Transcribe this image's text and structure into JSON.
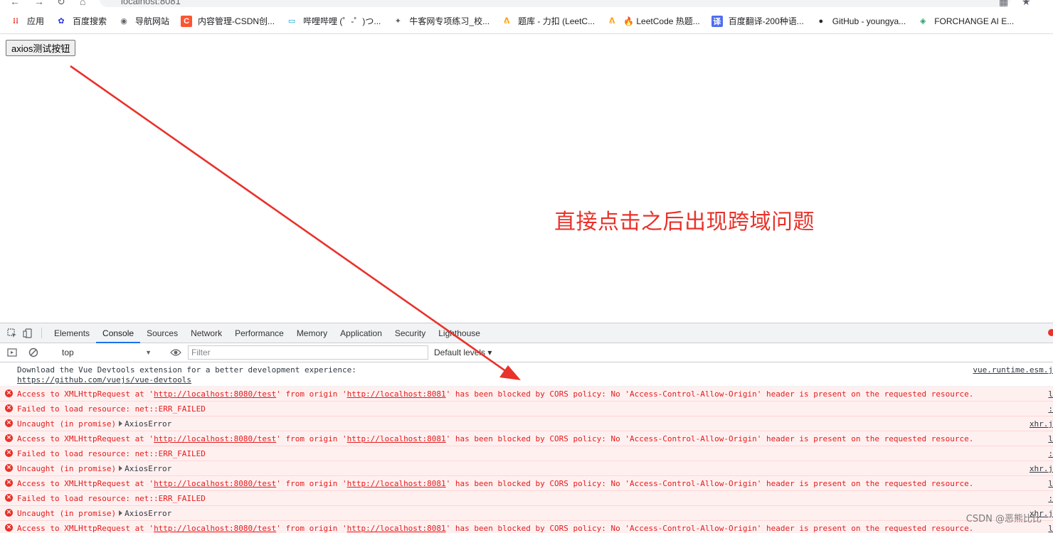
{
  "browser": {
    "address": "localhost:8081"
  },
  "bookmarks": [
    {
      "label": "应用",
      "icon": "apps-grid-icon",
      "color": "#ea4335"
    },
    {
      "label": "百度搜索",
      "icon": "baidu-paw-icon",
      "color": "#2932e1"
    },
    {
      "label": "导航网站",
      "icon": "globe-icon",
      "color": "#5f6368"
    },
    {
      "label": "内容管理-CSDN创...",
      "icon": "csdn-c-icon",
      "color": "#fc5531"
    },
    {
      "label": "哔哩哔哩 (゜-゜)つ...",
      "icon": "bilibili-tv-icon",
      "color": "#00a1d6"
    },
    {
      "label": "牛客网专项练习_校...",
      "icon": "nowcoder-icon",
      "color": "#5f6368"
    },
    {
      "label": "题库 - 力扣 (LeetC...",
      "icon": "leetcode-icon",
      "color": "#ffa116"
    },
    {
      "label": "🔥 LeetCode 热题...",
      "icon": "leetcode-icon",
      "color": "#ffa116"
    },
    {
      "label": "百度翻译-200种语...",
      "icon": "translate-icon",
      "color": "#4e6ef2"
    },
    {
      "label": "GitHub - youngya...",
      "icon": "github-icon",
      "color": "#24292e"
    },
    {
      "label": "FORCHANGE AI E...",
      "icon": "forchange-icon",
      "color": "#21a366"
    }
  ],
  "page": {
    "button_label": "axios测试按钮",
    "annotation": "直接点击之后出现跨域问题",
    "annotation_color": "#e8322a"
  },
  "devtools": {
    "tabs": [
      "Elements",
      "Console",
      "Sources",
      "Network",
      "Performance",
      "Memory",
      "Application",
      "Security",
      "Lighthouse"
    ],
    "active_tab": "Console",
    "context": "top",
    "filter_placeholder": "Filter",
    "levels": "Default levels ▾",
    "info": {
      "line1": "Download the Vue Devtools extension for a better development experience:",
      "link": "https://github.com/vuejs/vue-devtools",
      "source": "vue.runtime.esm.j"
    },
    "cors": {
      "p1": "Access to XMLHttpRequest at '",
      "url_target": "http://localhost:8080/test",
      "p2": "' from origin '",
      "url_origin": "http://localhost:8081",
      "p3": "' has been blocked by CORS policy: No 'Access-Control-Allow-Origin' header is present on the requested resource.",
      "source": "l"
    },
    "failed": {
      "text": "Failed to load resource: net::ERR_FAILED",
      "source": ":"
    },
    "uncaught": {
      "prefix": "Uncaught (in promise)",
      "error": "AxiosError",
      "source": "xhr.j"
    }
  },
  "watermark": "CSDN @恶熊比比"
}
